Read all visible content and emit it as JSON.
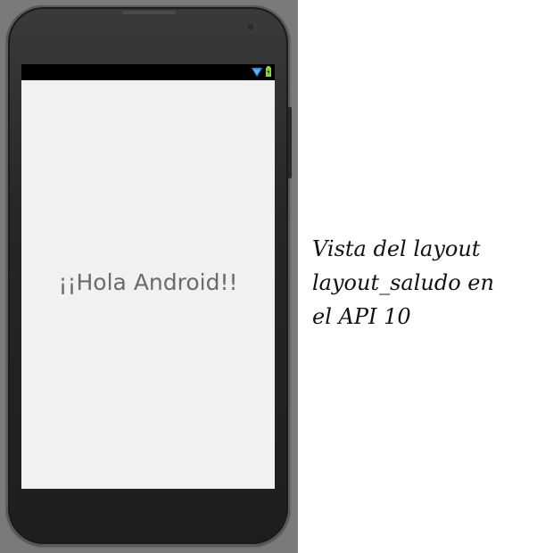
{
  "screen": {
    "greeting": "¡¡Hola Android!!",
    "status_icons": [
      "wifi-icon",
      "battery-icon"
    ]
  },
  "caption": {
    "lines": [
      "Vista del layout",
      "layout_saludo en",
      "el API 10"
    ]
  },
  "colors": {
    "emulator_background": "#7a7a7a",
    "phone_body": "#262626",
    "screen_background": "#f1f1f1",
    "status_bar": "#000000",
    "wifi": "#2f8cd8",
    "battery": "#8cd82f",
    "greeting_text": "#6b6b6b"
  }
}
